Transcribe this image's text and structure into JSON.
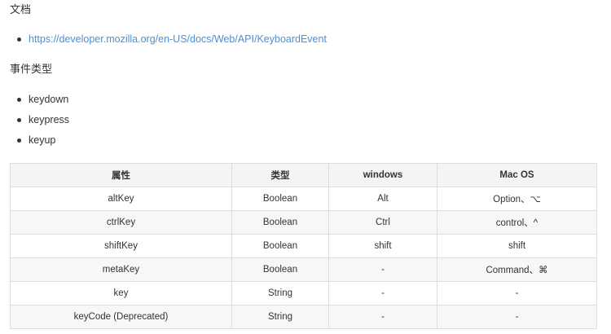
{
  "docs_heading": "文档",
  "docs_links": [
    "https://developer.mozilla.org/en-US/docs/Web/API/KeyboardEvent"
  ],
  "event_types_heading": "事件类型",
  "event_types": [
    "keydown",
    "keypress",
    "keyup"
  ],
  "table": {
    "headers": [
      "属性",
      "类型",
      "windows",
      "Mac OS"
    ],
    "rows": [
      [
        "altKey",
        "Boolean",
        "Alt",
        "Option、⌥"
      ],
      [
        "ctrlKey",
        "Boolean",
        "Ctrl",
        "control、^"
      ],
      [
        "shiftKey",
        "Boolean",
        "shift",
        "shift"
      ],
      [
        "metaKey",
        "Boolean",
        "-",
        "Command、⌘"
      ],
      [
        "key",
        "String",
        "-",
        "-"
      ],
      [
        "keyCode (Deprecated)",
        "String",
        "-",
        "-"
      ]
    ]
  }
}
